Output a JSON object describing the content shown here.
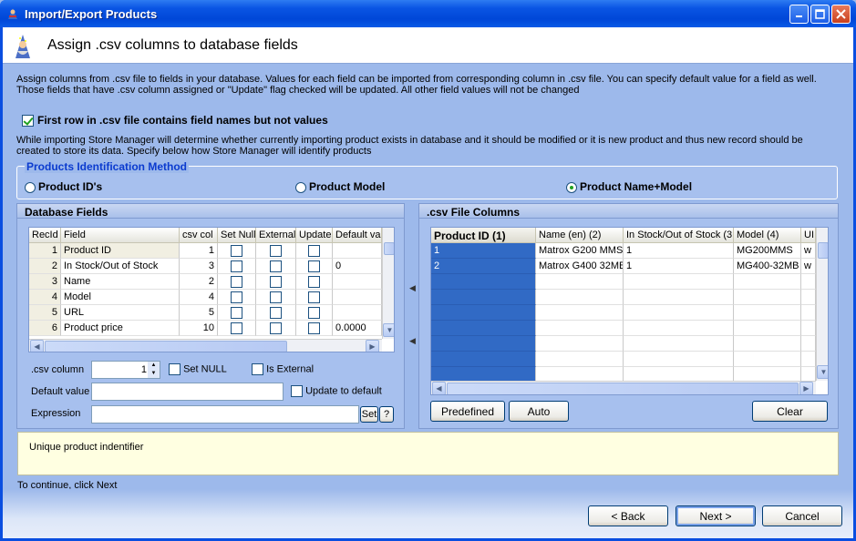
{
  "window": {
    "title": "Import/Export Products"
  },
  "header": {
    "title": "Assign .csv columns to database fields"
  },
  "description": "Assign columns from .csv file to fields in your database. Values for each field can be imported from corresponding column in .csv file. You can specify default value for a field as well. Those fields that have .csv column assigned or \"Update\" flag checked will be updated. All other field values will not be changed",
  "first_row_checkbox": {
    "label": "First row in .csv file contains field names but not values",
    "checked": true
  },
  "identify_text": "While importing Store Manager will determine whether currently importing product exists in database and it should be modified or it is new product and thus new record should be created to store its data. Specify below how Store Manager will identify products",
  "identification": {
    "legend": "Products Identification Method",
    "options": [
      {
        "label": "Product ID's",
        "selected": false
      },
      {
        "label": "Product Model",
        "selected": false
      },
      {
        "label": "Product Name+Model",
        "selected": true
      }
    ]
  },
  "db_fields": {
    "title": "Database Fields",
    "columns": [
      "RecId",
      "Field",
      "csv col",
      "Set Null",
      "External",
      "Update",
      "Default va"
    ],
    "rows": [
      {
        "recid": "1",
        "field": "Product ID",
        "csv": "1",
        "default": ""
      },
      {
        "recid": "2",
        "field": "In Stock/Out of Stock",
        "csv": "3",
        "default": "0"
      },
      {
        "recid": "3",
        "field": "Name",
        "csv": "2",
        "default": ""
      },
      {
        "recid": "4",
        "field": "Model",
        "csv": "4",
        "default": ""
      },
      {
        "recid": "5",
        "field": "URL",
        "csv": "5",
        "default": ""
      },
      {
        "recid": "6",
        "field": "Product price",
        "csv": "10",
        "default": "0.0000"
      }
    ],
    "csv_column_label": ".csv column",
    "csv_column_value": "1",
    "set_null_label": "Set NULL",
    "is_external_label": "Is External",
    "default_value_label": "Default value",
    "update_default_label": "Update to default",
    "expression_label": "Expression",
    "set_button": "Set",
    "help_button": "?"
  },
  "csv_columns": {
    "title": ".csv File Columns",
    "columns": [
      "Product ID (1)",
      "Name (en) (2)",
      "In Stock/Out of Stock (3",
      "Model (4)",
      "UI"
    ],
    "rows": [
      [
        "1",
        "Matrox G200 MMS",
        "1",
        "MG200MMS",
        "w"
      ],
      [
        "2",
        "Matrox G400 32MB",
        "1",
        "MG400-32MB",
        "w"
      ]
    ],
    "buttons": {
      "predefined": "Predefined",
      "auto": "Auto",
      "clear": "Clear"
    }
  },
  "info_text": "Unique product indentifier",
  "continue_text": "To continue, click Next",
  "footer": {
    "back": "< Back",
    "next": "Next >",
    "cancel": "Cancel"
  },
  "colors": {
    "accent": "#316ac5",
    "selected_column": "#316ac5",
    "panel": "#9db9eb"
  }
}
